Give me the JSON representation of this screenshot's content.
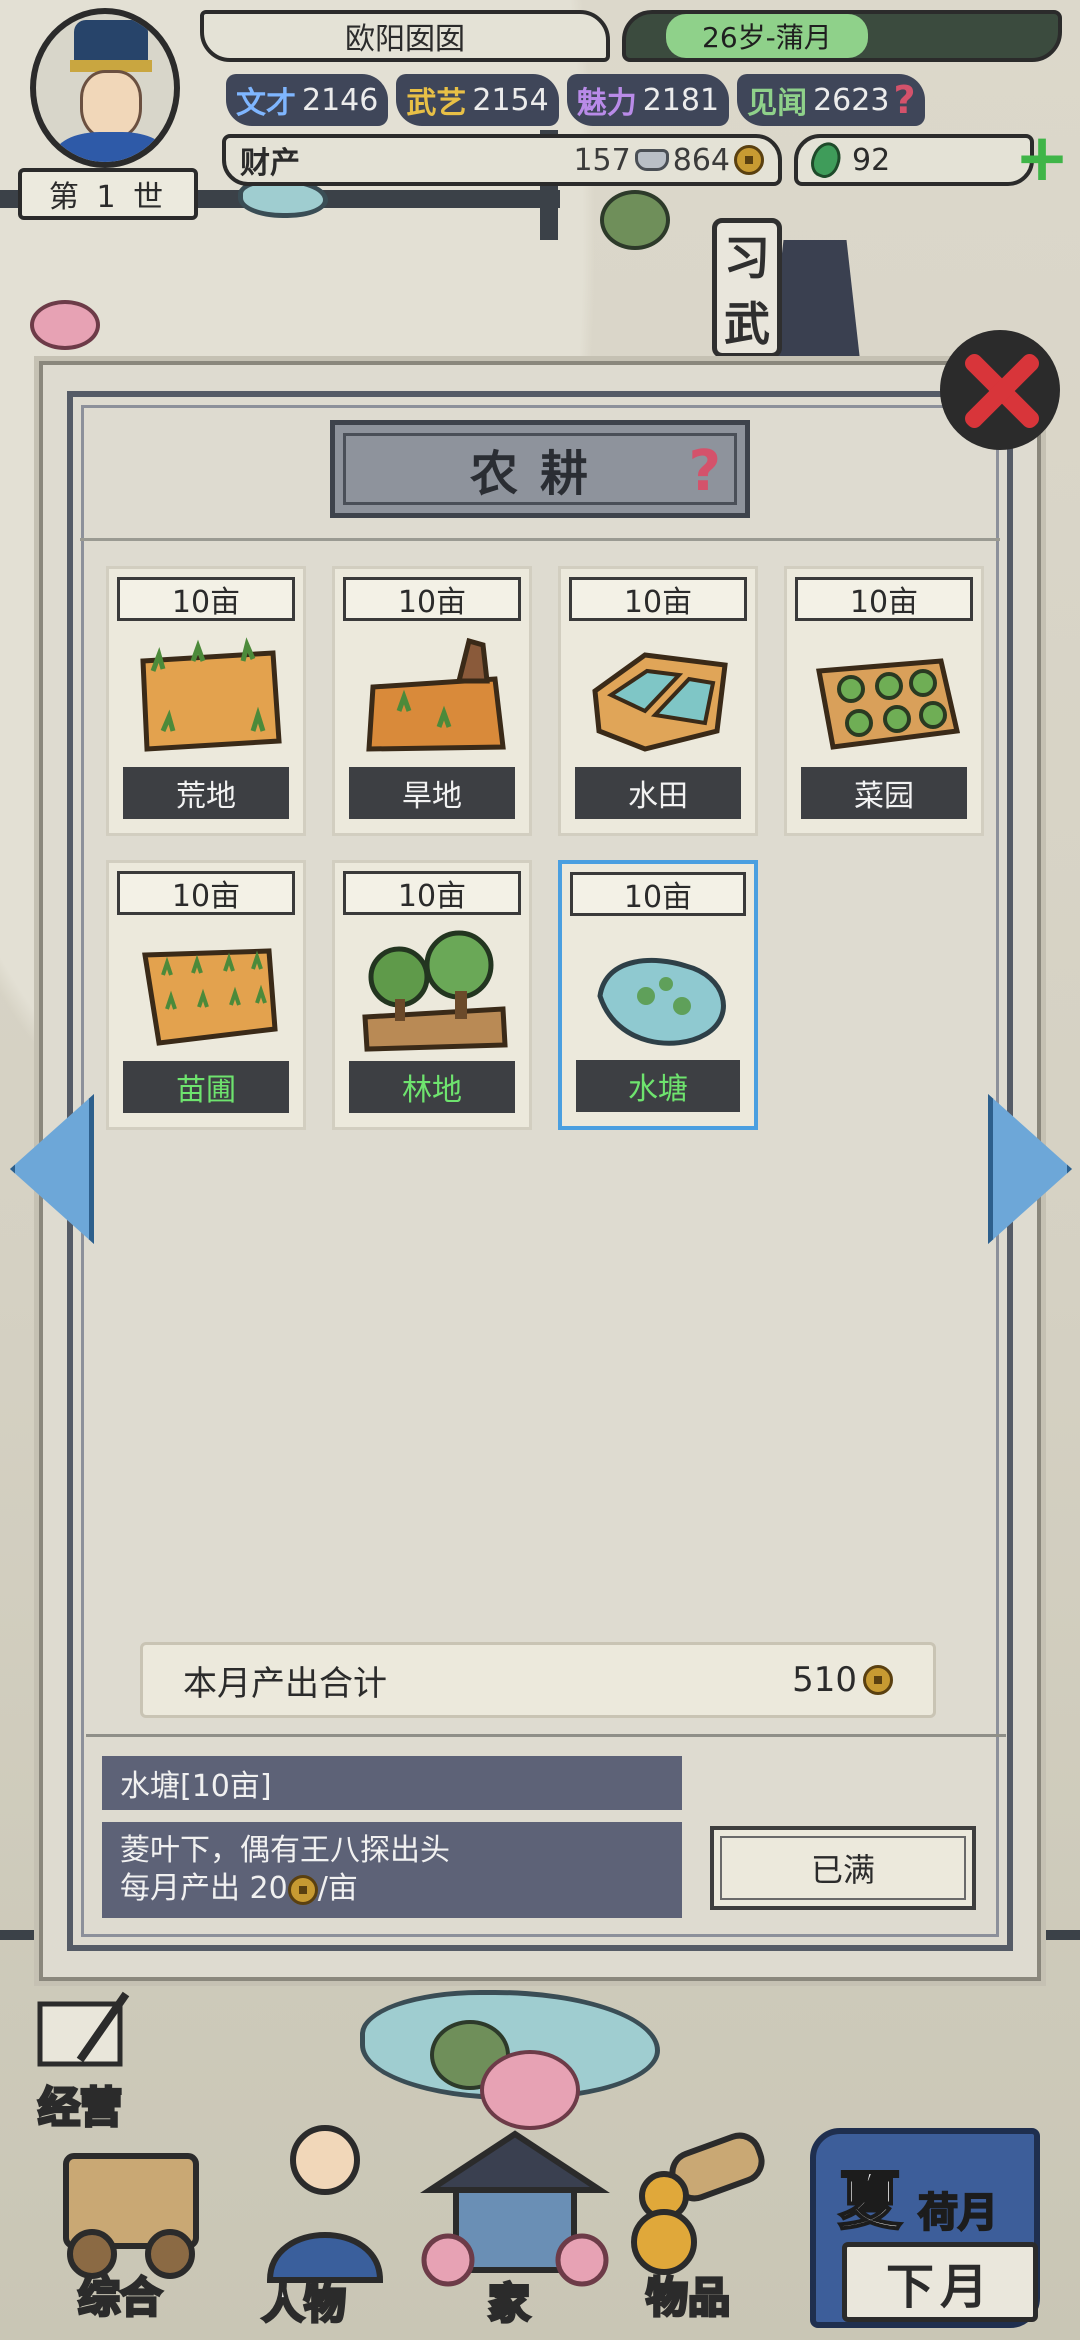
{
  "player": {
    "name": "欧阳囡囡",
    "age_season": "26岁-蒲月",
    "generation": "第 1 世"
  },
  "stats": [
    {
      "label": "文才",
      "value": "2146",
      "color": "#7fb6ff"
    },
    {
      "label": "武艺",
      "value": "2154",
      "color": "#e8c046"
    },
    {
      "label": "魅力",
      "value": "2181",
      "color": "#b98be8"
    },
    {
      "label": "见闻",
      "value": "2623",
      "color": "#8fd18a"
    }
  ],
  "wealth": {
    "label": "财产",
    "silver": "157",
    "copper": "864",
    "jade": "92"
  },
  "panel": {
    "title": "农耕",
    "help_icon": "question-icon",
    "lands": [
      {
        "size": "10亩",
        "name": "荒地",
        "locked": false,
        "selected": false
      },
      {
        "size": "10亩",
        "name": "旱地",
        "locked": false,
        "selected": false
      },
      {
        "size": "10亩",
        "name": "水田",
        "locked": false,
        "selected": false
      },
      {
        "size": "10亩",
        "name": "菜园",
        "locked": false,
        "selected": false
      },
      {
        "size": "10亩",
        "name": "苗圃",
        "locked": true,
        "selected": false
      },
      {
        "size": "10亩",
        "name": "林地",
        "locked": true,
        "selected": false
      },
      {
        "size": "10亩",
        "name": "水塘",
        "locked": true,
        "selected": true
      }
    ],
    "output_label": "本月产出合计",
    "output_value": "510",
    "detail": {
      "title": "水塘[10亩]",
      "desc_line1": "菱叶下，偶有王八探出头",
      "desc_line2_prefix": "每月产出 20",
      "desc_line2_suffix": "/亩",
      "button": "已满"
    }
  },
  "map_sign": {
    "line1": "习",
    "line2": "武"
  },
  "bottom_nav": {
    "jingying": "经营",
    "zonghe": "综合",
    "renwu": "人物",
    "jia": "家",
    "wupin": "物品",
    "season": "夏",
    "month": "荷月",
    "next": "下月"
  },
  "colors": {
    "selected_border": "#4a9fe0",
    "locked_name": "#6ee36e",
    "help": "#d4526b",
    "close": "#d8353a"
  }
}
